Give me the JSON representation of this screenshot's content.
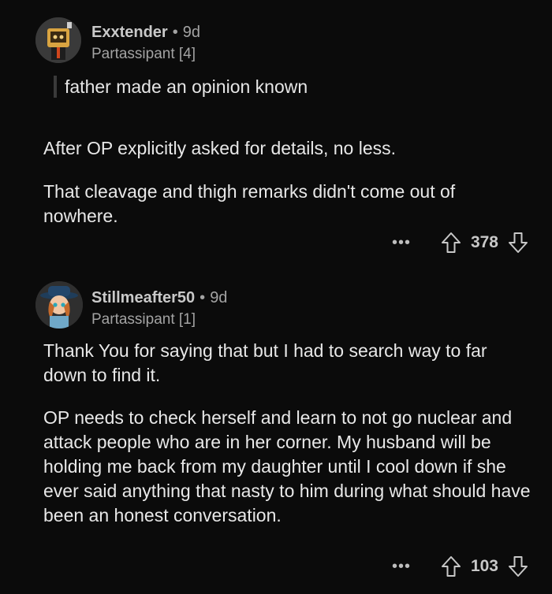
{
  "comments": [
    {
      "username": "Exxtender",
      "separator": "•",
      "age": "9d",
      "flair": "Partassipant [4]",
      "quote": "father made an opinion known",
      "paragraphs": [
        "After OP explicitly asked for details, no less.",
        "That cleavage and thigh remarks didn't come out of nowhere."
      ],
      "more_label": "•••",
      "score": "378"
    },
    {
      "username": "Stillmeafter50",
      "separator": "•",
      "age": "9d",
      "flair": "Partassipant [1]",
      "paragraphs": [
        "Thank You for saying that but I had to search way to far down to find it.",
        "OP needs to check herself and learn to not go nuclear and attack people who are in her corner.   My husband will be holding me back from my daughter until I cool down if she ever said anything that nasty to him during what should have been an honest conversation."
      ],
      "more_label": "•••",
      "score": "103"
    }
  ],
  "colors": {
    "background": "#0b0b0b",
    "text": "#e8e8e8",
    "muted": "#a3a3a3"
  }
}
